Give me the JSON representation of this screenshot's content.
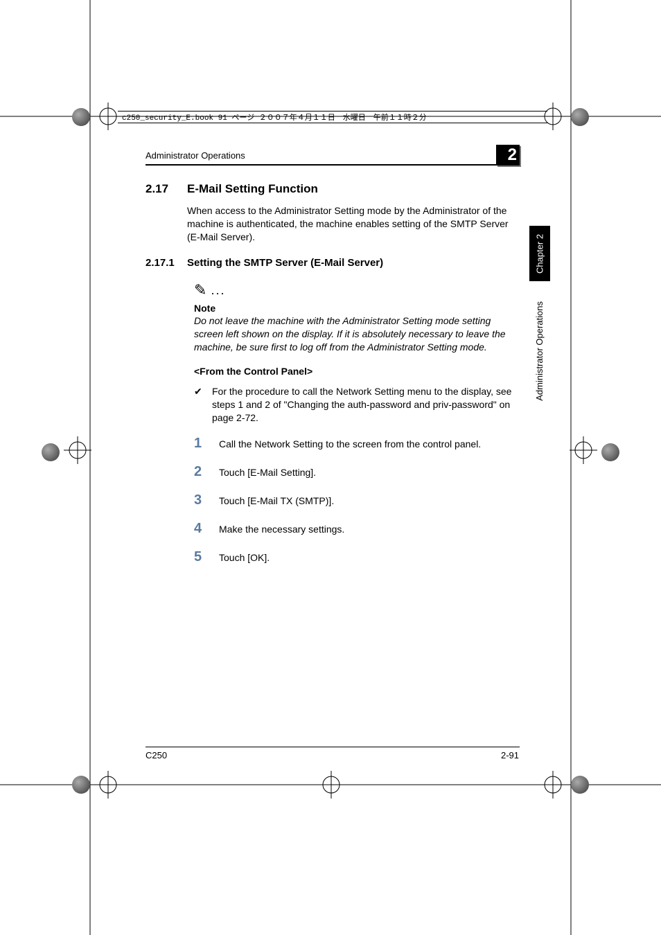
{
  "slug": "c250_security_E.book  91 ページ  ２００７年４月１１日　水曜日　午前１１時２分",
  "running_head": "Administrator Operations",
  "chapter_number": "2",
  "side_tab_chapter": "Chapter 2",
  "side_tab_title": "Administrator Operations",
  "section": {
    "num": "2.17",
    "title": "E-Mail Setting Function",
    "intro": "When access to the Administrator Setting mode by the Administrator of the machine is authenticated, the machine enables setting of the SMTP Server (E-Mail Server)."
  },
  "subsection": {
    "num": "2.17.1",
    "title": "Setting the SMTP Server (E-Mail Server)"
  },
  "note": {
    "label": "Note",
    "body": "Do not leave the machine with the Administrator Setting mode setting screen left shown on the display. If it is absolutely necessary to leave the machine, be sure first to log off from the Administrator Setting mode."
  },
  "panel_head": "<From the Control Panel>",
  "check_item": "For the procedure to call the Network Setting menu to the display, see steps 1 and 2 of \"Changing the auth-password and priv-password\" on page 2-72.",
  "steps": [
    "Call the Network Setting to the screen from the control panel.",
    "Touch [E-Mail Setting].",
    "Touch [E-Mail TX (SMTP)].",
    "Make the necessary settings.",
    "Touch [OK]."
  ],
  "footer": {
    "left": "C250",
    "right": "2-91"
  }
}
